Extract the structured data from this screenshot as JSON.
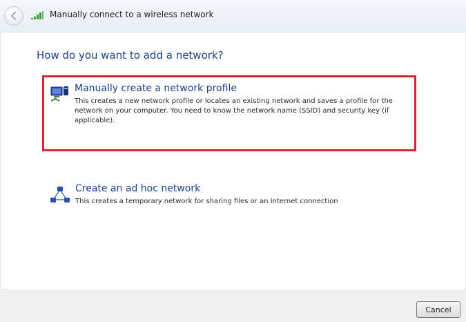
{
  "window": {
    "title": "Manually connect to a wireless network"
  },
  "main": {
    "heading": "How do you want to add a network?",
    "options": [
      {
        "title": "Manually create a network profile",
        "description": "This creates a new network profile or locates an existing network and saves a profile for the network on your computer. You need to know the network name (SSID) and security key (if applicable).",
        "icon": "network-profile-icon",
        "highlighted": true
      },
      {
        "title": "Create an ad hoc network",
        "description": "This creates a temporary network for sharing files or an Internet connection",
        "icon": "ad-hoc-network-icon",
        "highlighted": false
      }
    ]
  },
  "footer": {
    "cancel_label": "Cancel"
  },
  "colors": {
    "heading": "#1f3f8c",
    "highlight_border": "#d9232d",
    "footer_bg": "#f0f0f0"
  }
}
